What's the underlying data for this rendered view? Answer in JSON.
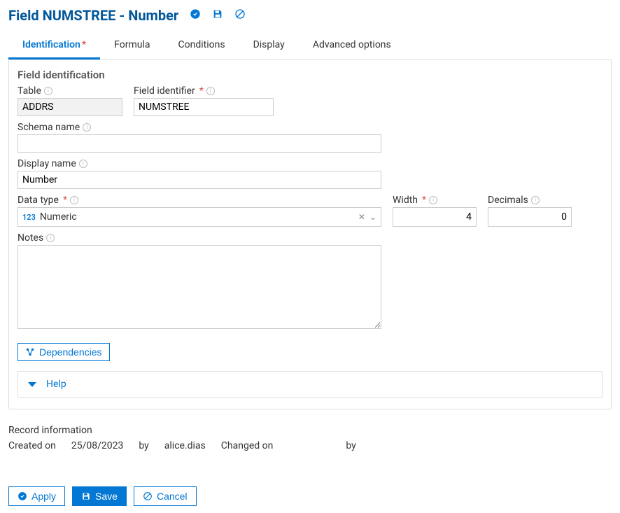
{
  "header": {
    "title": "Field NUMSTREE - Number"
  },
  "tabs": {
    "identification": "Identification",
    "formula": "Formula",
    "conditions": "Conditions",
    "display": "Display",
    "advanced": "Advanced options"
  },
  "section": {
    "title": "Field identification",
    "table_label": "Table",
    "table_value": "ADDRS",
    "field_id_label": "Field identifier",
    "field_id_value": "NUMSTREE",
    "schema_label": "Schema name",
    "schema_value": "",
    "display_label": "Display name",
    "display_value": "Number",
    "datatype_label": "Data type",
    "datatype_tag": "123",
    "datatype_value": "Numeric",
    "width_label": "Width",
    "width_value": "4",
    "decimals_label": "Decimals",
    "decimals_value": "0",
    "notes_label": "Notes",
    "notes_value": "",
    "dependencies": "Dependencies",
    "help": "Help"
  },
  "record": {
    "title": "Record information",
    "created_on_label": "Created on",
    "created_on_value": "25/08/2023",
    "by_label": "by",
    "created_by_value": "alice.dias",
    "changed_on_label": "Changed on",
    "changed_on_value": "",
    "changed_by_value": ""
  },
  "buttons": {
    "apply": "Apply",
    "save": "Save",
    "cancel": "Cancel"
  }
}
